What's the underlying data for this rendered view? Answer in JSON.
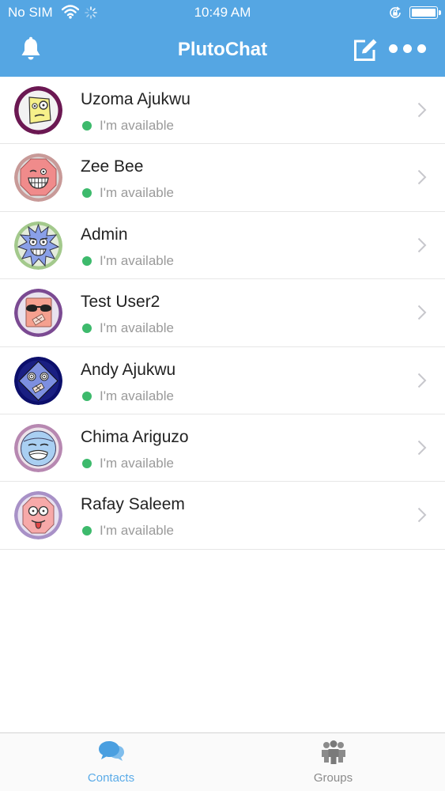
{
  "status_bar": {
    "carrier": "No SIM",
    "time": "10:49 AM"
  },
  "header": {
    "title": "PlutoChat"
  },
  "colors": {
    "accent": "#55a6e3",
    "online": "#3dba6c"
  },
  "contacts": [
    {
      "name": "Uzoma Ajukwu",
      "status": "I'm available"
    },
    {
      "name": "Zee Bee",
      "status": "I'm available"
    },
    {
      "name": "Admin",
      "status": "I'm available"
    },
    {
      "name": "Test User2",
      "status": "I'm available"
    },
    {
      "name": "Andy Ajukwu",
      "status": "I'm available"
    },
    {
      "name": "Chima Ariguzo",
      "status": "I'm available"
    },
    {
      "name": "Rafay Saleem",
      "status": "I'm available"
    }
  ],
  "tabs": [
    {
      "label": "Contacts",
      "icon": "chat-bubbles-icon",
      "active": true
    },
    {
      "label": "Groups",
      "icon": "group-people-icon",
      "active": false
    }
  ]
}
